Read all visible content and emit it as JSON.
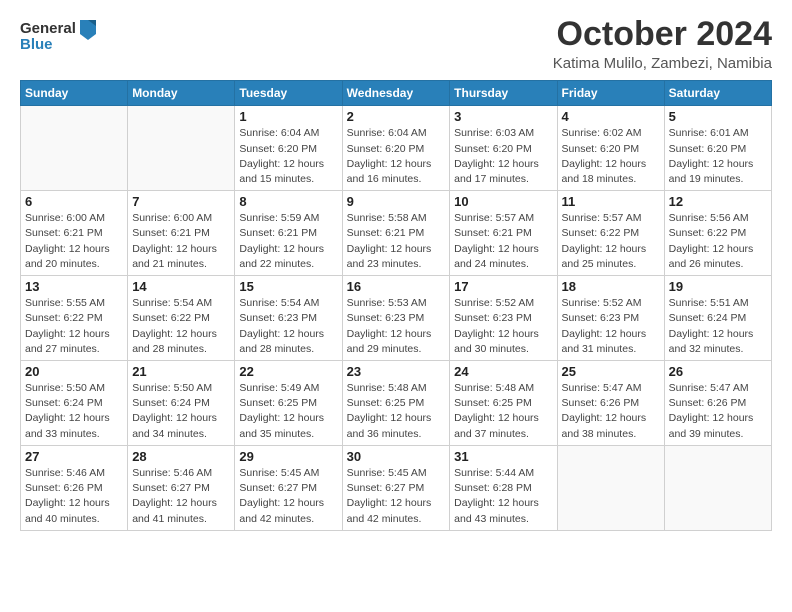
{
  "header": {
    "logo": {
      "line1": "General",
      "line2": "Blue"
    },
    "title": "October 2024",
    "location": "Katima Mulilo, Zambezi, Namibia"
  },
  "weekdays": [
    "Sunday",
    "Monday",
    "Tuesday",
    "Wednesday",
    "Thursday",
    "Friday",
    "Saturday"
  ],
  "weeks": [
    [
      {
        "day": "",
        "detail": ""
      },
      {
        "day": "",
        "detail": ""
      },
      {
        "day": "1",
        "detail": "Sunrise: 6:04 AM\nSunset: 6:20 PM\nDaylight: 12 hours and 15 minutes."
      },
      {
        "day": "2",
        "detail": "Sunrise: 6:04 AM\nSunset: 6:20 PM\nDaylight: 12 hours and 16 minutes."
      },
      {
        "day": "3",
        "detail": "Sunrise: 6:03 AM\nSunset: 6:20 PM\nDaylight: 12 hours and 17 minutes."
      },
      {
        "day": "4",
        "detail": "Sunrise: 6:02 AM\nSunset: 6:20 PM\nDaylight: 12 hours and 18 minutes."
      },
      {
        "day": "5",
        "detail": "Sunrise: 6:01 AM\nSunset: 6:20 PM\nDaylight: 12 hours and 19 minutes."
      }
    ],
    [
      {
        "day": "6",
        "detail": "Sunrise: 6:00 AM\nSunset: 6:21 PM\nDaylight: 12 hours and 20 minutes."
      },
      {
        "day": "7",
        "detail": "Sunrise: 6:00 AM\nSunset: 6:21 PM\nDaylight: 12 hours and 21 minutes."
      },
      {
        "day": "8",
        "detail": "Sunrise: 5:59 AM\nSunset: 6:21 PM\nDaylight: 12 hours and 22 minutes."
      },
      {
        "day": "9",
        "detail": "Sunrise: 5:58 AM\nSunset: 6:21 PM\nDaylight: 12 hours and 23 minutes."
      },
      {
        "day": "10",
        "detail": "Sunrise: 5:57 AM\nSunset: 6:21 PM\nDaylight: 12 hours and 24 minutes."
      },
      {
        "day": "11",
        "detail": "Sunrise: 5:57 AM\nSunset: 6:22 PM\nDaylight: 12 hours and 25 minutes."
      },
      {
        "day": "12",
        "detail": "Sunrise: 5:56 AM\nSunset: 6:22 PM\nDaylight: 12 hours and 26 minutes."
      }
    ],
    [
      {
        "day": "13",
        "detail": "Sunrise: 5:55 AM\nSunset: 6:22 PM\nDaylight: 12 hours and 27 minutes."
      },
      {
        "day": "14",
        "detail": "Sunrise: 5:54 AM\nSunset: 6:22 PM\nDaylight: 12 hours and 28 minutes."
      },
      {
        "day": "15",
        "detail": "Sunrise: 5:54 AM\nSunset: 6:23 PM\nDaylight: 12 hours and 28 minutes."
      },
      {
        "day": "16",
        "detail": "Sunrise: 5:53 AM\nSunset: 6:23 PM\nDaylight: 12 hours and 29 minutes."
      },
      {
        "day": "17",
        "detail": "Sunrise: 5:52 AM\nSunset: 6:23 PM\nDaylight: 12 hours and 30 minutes."
      },
      {
        "day": "18",
        "detail": "Sunrise: 5:52 AM\nSunset: 6:23 PM\nDaylight: 12 hours and 31 minutes."
      },
      {
        "day": "19",
        "detail": "Sunrise: 5:51 AM\nSunset: 6:24 PM\nDaylight: 12 hours and 32 minutes."
      }
    ],
    [
      {
        "day": "20",
        "detail": "Sunrise: 5:50 AM\nSunset: 6:24 PM\nDaylight: 12 hours and 33 minutes."
      },
      {
        "day": "21",
        "detail": "Sunrise: 5:50 AM\nSunset: 6:24 PM\nDaylight: 12 hours and 34 minutes."
      },
      {
        "day": "22",
        "detail": "Sunrise: 5:49 AM\nSunset: 6:25 PM\nDaylight: 12 hours and 35 minutes."
      },
      {
        "day": "23",
        "detail": "Sunrise: 5:48 AM\nSunset: 6:25 PM\nDaylight: 12 hours and 36 minutes."
      },
      {
        "day": "24",
        "detail": "Sunrise: 5:48 AM\nSunset: 6:25 PM\nDaylight: 12 hours and 37 minutes."
      },
      {
        "day": "25",
        "detail": "Sunrise: 5:47 AM\nSunset: 6:26 PM\nDaylight: 12 hours and 38 minutes."
      },
      {
        "day": "26",
        "detail": "Sunrise: 5:47 AM\nSunset: 6:26 PM\nDaylight: 12 hours and 39 minutes."
      }
    ],
    [
      {
        "day": "27",
        "detail": "Sunrise: 5:46 AM\nSunset: 6:26 PM\nDaylight: 12 hours and 40 minutes."
      },
      {
        "day": "28",
        "detail": "Sunrise: 5:46 AM\nSunset: 6:27 PM\nDaylight: 12 hours and 41 minutes."
      },
      {
        "day": "29",
        "detail": "Sunrise: 5:45 AM\nSunset: 6:27 PM\nDaylight: 12 hours and 42 minutes."
      },
      {
        "day": "30",
        "detail": "Sunrise: 5:45 AM\nSunset: 6:27 PM\nDaylight: 12 hours and 42 minutes."
      },
      {
        "day": "31",
        "detail": "Sunrise: 5:44 AM\nSunset: 6:28 PM\nDaylight: 12 hours and 43 minutes."
      },
      {
        "day": "",
        "detail": ""
      },
      {
        "day": "",
        "detail": ""
      }
    ]
  ]
}
